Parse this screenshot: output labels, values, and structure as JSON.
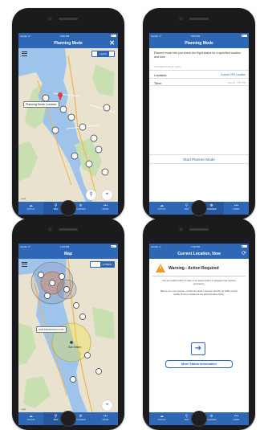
{
  "phones": [
    {
      "status": {
        "carrier": "Carrier ᯤ",
        "time": "5:52 PM"
      },
      "nav": {
        "title": "Planning Mode",
        "right": "✕"
      },
      "map": {
        "segment": [
          "",
          "Hybrid",
          ""
        ],
        "callout": "Planning Mode Location",
        "legal": "Legal",
        "controls": {
          "left": "⚲",
          "right": "⌖"
        }
      }
    },
    {
      "status": {
        "carrier": "Carrier ᯤ",
        "time": "5:53 PM"
      },
      "nav": {
        "title": "Planning Mode"
      },
      "description": "Planner mode lets you check the flight status for a specified location and time.",
      "section": "FUTURE FLIGHT INFO",
      "rows": [
        {
          "label": "Location:",
          "value": "Current GPS Location"
        },
        {
          "label": "Time:",
          "value": "Jun 20 7:57 PM"
        }
      ],
      "start_button": "Start Planner Mode"
    },
    {
      "status": {
        "carrier": "Carrier ᯤ",
        "time": "1:43 PM"
      },
      "nav": {
        "title": "Map"
      },
      "map": {
        "segment": [
          "",
          "",
          "HYBRID"
        ],
        "callout": "SAN FRANCISCO INTL",
        "city": "San Mateo",
        "legal": "Legal",
        "controls": {
          "right": "⌖"
        }
      }
    },
    {
      "status": {
        "carrier": "Carrier ᯤ",
        "time": "1:43 PM"
      },
      "nav": {
        "title": "Current Location, Now",
        "right": "⟳"
      },
      "warning": {
        "title": "Warning - Action Required",
        "body1": "You are located within 5 miles of an airport and/or in airspace that requires permission.",
        "body2": "Before you may operate, contact the airport operator and the air traffic control facility (if one is located at the airport) before flying."
      },
      "more_button": "More Status Information"
    }
  ],
  "tabs": [
    {
      "icon": "☁",
      "label": "STATUS"
    },
    {
      "icon": "⚲",
      "label": "MAP"
    },
    {
      "icon": "⛯",
      "label": "PLANNER"
    },
    {
      "icon": "•••",
      "label": "MORE"
    }
  ],
  "colors": {
    "primary": "#2e67b6",
    "warning": "#f39a1e",
    "water": "#9fc4ec",
    "land": "#e8e2cf",
    "park": "#c8dfb0"
  }
}
